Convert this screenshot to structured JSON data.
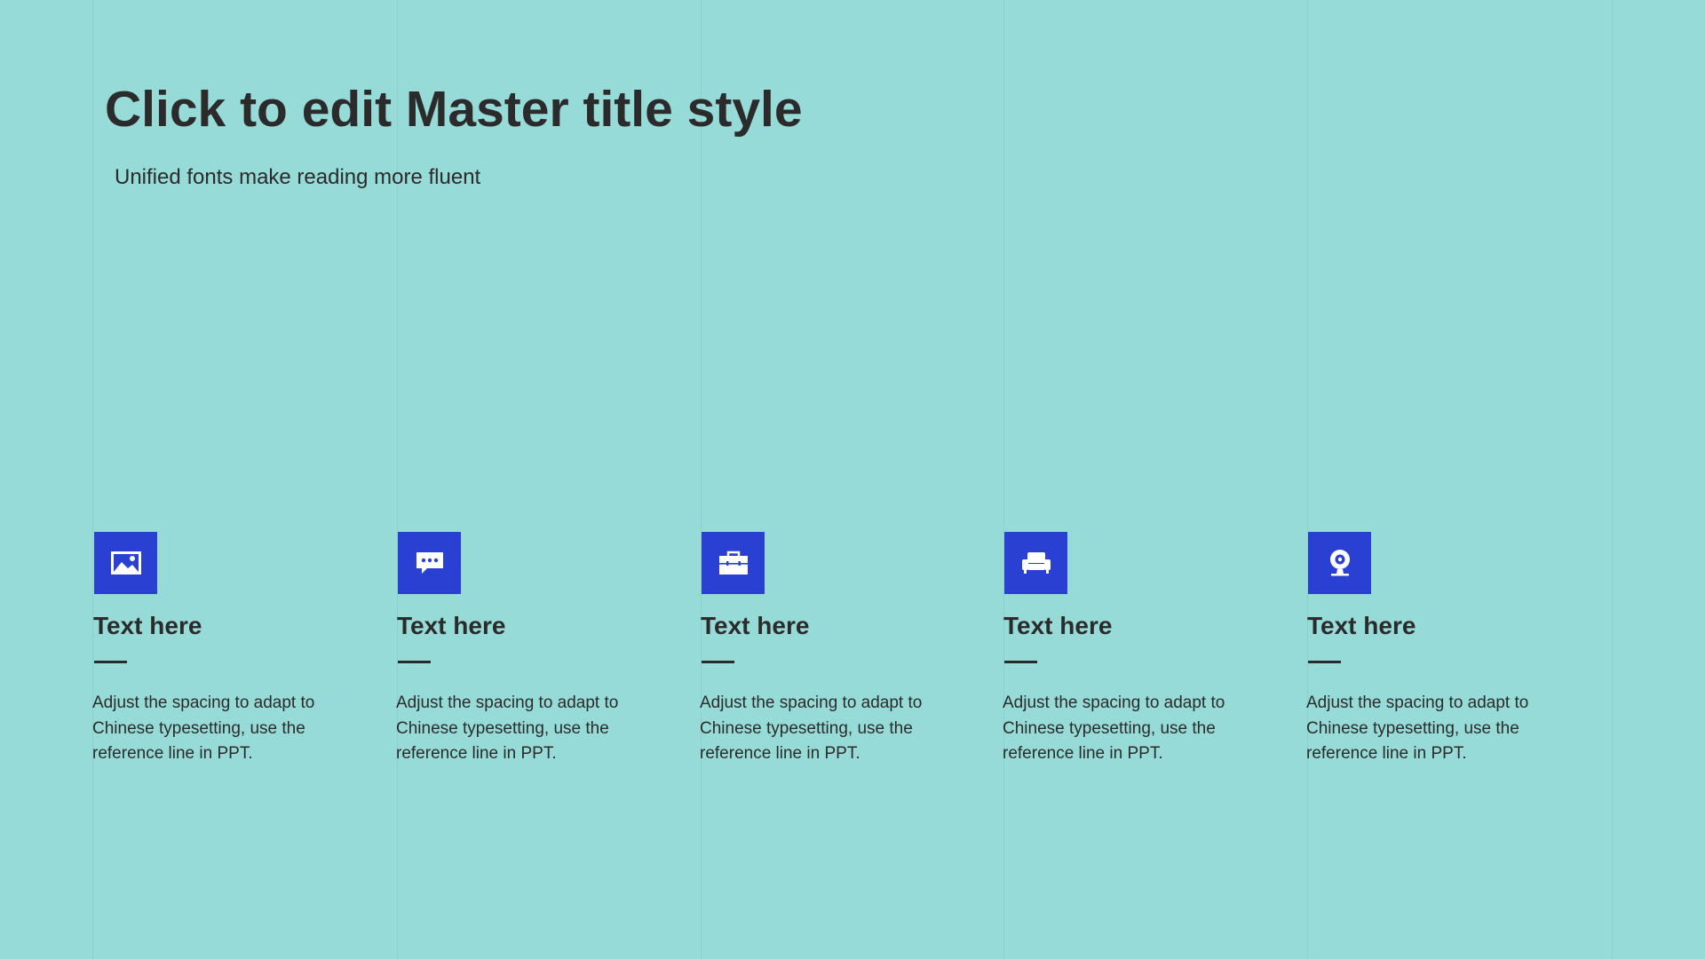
{
  "slide": {
    "title": "Click to edit Master title style",
    "subtitle": "Unified fonts make reading more fluent"
  },
  "theme": {
    "background": "#96dbd7",
    "accent": "#2940d3",
    "text": "#2b2b2b"
  },
  "features": [
    {
      "icon": "image-icon",
      "title": "Text here",
      "body": "Adjust the spacing to adapt to Chinese typesetting, use the reference line in PPT."
    },
    {
      "icon": "chat-bubble-icon",
      "title": "Text here",
      "body": "Adjust the spacing to adapt to Chinese typesetting, use the reference line in PPT."
    },
    {
      "icon": "briefcase-icon",
      "title": "Text here",
      "body": "Adjust the spacing to adapt to Chinese typesetting, use the reference line in PPT."
    },
    {
      "icon": "armchair-icon",
      "title": "Text here",
      "body": "Adjust the spacing to adapt to Chinese typesetting, use the reference line in PPT."
    },
    {
      "icon": "webcam-icon",
      "title": "Text here",
      "body": "Adjust the spacing to adapt to Chinese typesetting, use the reference line in PPT."
    }
  ]
}
